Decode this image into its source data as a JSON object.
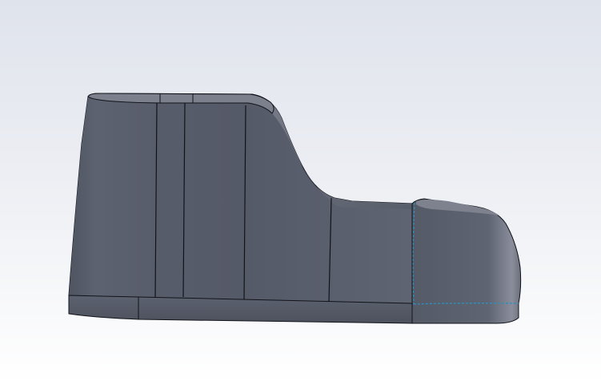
{
  "viewport": {
    "background_top": "#dfe3ec",
    "background_bottom": "#ffffff"
  },
  "model": {
    "body_color": "#585d6b",
    "body_highlight": "#8d919e",
    "edge_color": "#111318",
    "selected_edge_color": "#2b8fbf",
    "selected_face": "toe-cap"
  }
}
